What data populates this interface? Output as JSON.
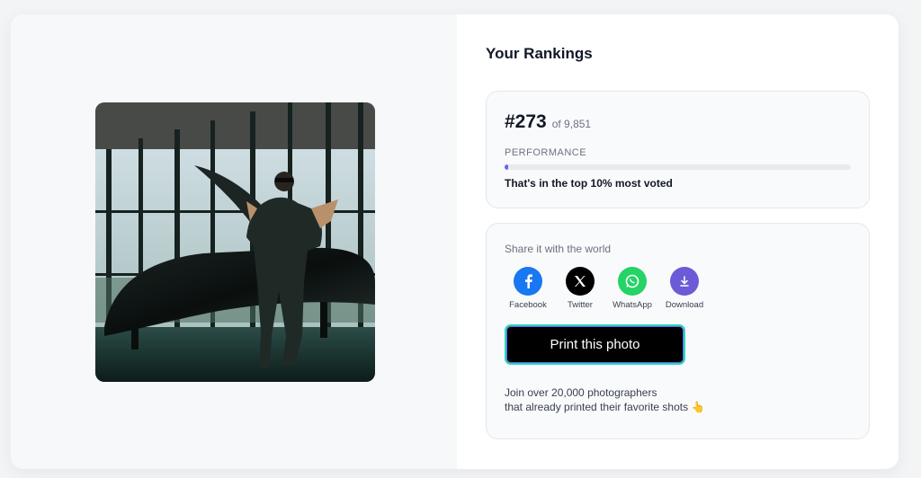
{
  "rankings": {
    "title": "Your Rankings",
    "rank": "#273",
    "of_total": "of 9,851",
    "performance_label": "PERFORMANCE",
    "performance_fraction": 0.01,
    "summary": "That's in the top 10% most voted"
  },
  "share": {
    "title": "Share it with the world",
    "items": [
      {
        "label": "Facebook",
        "icon": "facebook-icon",
        "color": "#1877f2"
      },
      {
        "label": "Twitter",
        "icon": "x-icon",
        "color": "#000000"
      },
      {
        "label": "WhatsApp",
        "icon": "whatsapp-icon",
        "color": "#25d366"
      },
      {
        "label": "Download",
        "icon": "download-icon",
        "color": "#6b5bd6"
      }
    ],
    "print_label": "Print this photo",
    "join_line1": "Join over 20,000 photographers",
    "join_line2": "that already printed their favorite shots 👆"
  },
  "colors": {
    "accent": "#6366f1",
    "button_border": "#2dd4bf"
  }
}
